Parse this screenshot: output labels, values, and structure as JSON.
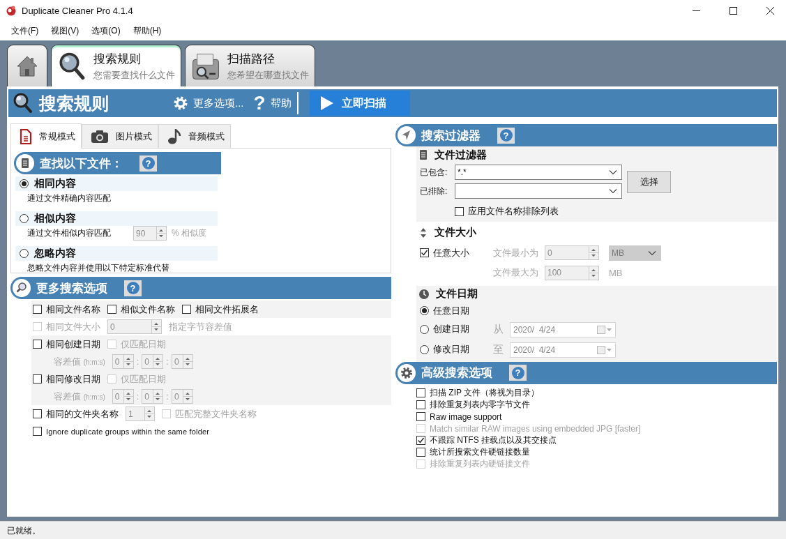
{
  "window": {
    "title": "Duplicate Cleaner Pro 4.1.4"
  },
  "menu": [
    "文件(F)",
    "视图(V)",
    "选项(O)",
    "帮助(H)"
  ],
  "main_tabs": [
    {
      "kind": "home",
      "selected": false
    },
    {
      "kind": "search",
      "title": "搜索规则",
      "subtitle": "您需要查找什么文件",
      "selected": true
    },
    {
      "kind": "scan",
      "title": "扫描路径",
      "subtitle": "您希望在哪查找文件",
      "selected": false
    }
  ],
  "header": {
    "title": "搜索规则",
    "actions": [
      {
        "kind": "more",
        "label": "更多选项..."
      },
      {
        "kind": "help",
        "icon": "?",
        "label": "帮助"
      }
    ],
    "scan_button": "立即扫描"
  },
  "mode_tabs": [
    {
      "kind": "document",
      "label": "常规模式",
      "selected": true
    },
    {
      "kind": "camera",
      "label": "图片模式",
      "selected": false
    },
    {
      "kind": "music",
      "label": "音频模式",
      "selected": false
    }
  ],
  "find_files": {
    "title": "查找以下文件：",
    "help": "?",
    "options": [
      {
        "label": "相同内容",
        "description": "通过文件精确内容匹配",
        "selected": true
      },
      {
        "label": "相似内容",
        "description": "通过文件相似内容匹配",
        "selected": false,
        "similarity": {
          "value": "90",
          "unit": "% 相似度",
          "disabled": true
        }
      },
      {
        "label": "忽略内容",
        "description": "忽略文件内容并使用以下特定标准代替",
        "selected": false
      }
    ]
  },
  "more_options": {
    "title": "更多搜索选项",
    "help": "?",
    "rows": [
      {
        "shaded": true,
        "items": [
          {
            "kind": "checkbox",
            "label": "相同文件名称",
            "checked": false,
            "disabled": false
          },
          {
            "kind": "checkbox",
            "label": "相似文件名称",
            "checked": false,
            "disabled": false
          },
          {
            "kind": "checkbox",
            "label": "相同文件拓展名",
            "checked": false,
            "disabled": false
          }
        ]
      },
      {
        "shaded": false,
        "items": [
          {
            "kind": "checkbox",
            "label": "相同文件大小",
            "checked": false,
            "disabled": true
          },
          {
            "kind": "spin",
            "value": "0",
            "disabled": true
          },
          {
            "kind": "note",
            "label": "指定字节容差值",
            "disabled": true
          }
        ]
      },
      {
        "shaded": true,
        "items": [
          {
            "kind": "checkbox",
            "label": "相同创建日期",
            "checked": false,
            "disabled": false
          },
          {
            "kind": "checkbox",
            "label": "仅匹配日期",
            "checked": false,
            "disabled": true
          }
        ]
      },
      {
        "shaded": true,
        "items": [
          {
            "kind": "tolerance",
            "label": "容差值",
            "unit": "(h:m:s)",
            "values": [
              "0",
              "0",
              "0"
            ],
            "separators": [
              ":",
              ":"
            ],
            "disabled": true
          }
        ]
      },
      {
        "shaded": true,
        "items": [
          {
            "kind": "checkbox",
            "label": "相同修改日期",
            "checked": false,
            "disabled": false
          },
          {
            "kind": "checkbox",
            "label": "仅匹配日期",
            "checked": false,
            "disabled": true
          }
        ]
      },
      {
        "shaded": true,
        "items": [
          {
            "kind": "tolerance",
            "label": "容差值",
            "unit": "(h:m:s)",
            "values": [
              "0",
              "0",
              "0"
            ],
            "separators": [
              ":",
              ":"
            ],
            "disabled": true
          }
        ]
      },
      {
        "shaded": false,
        "items": [
          {
            "kind": "checkbox",
            "label": "相同的文件夹名称",
            "checked": false,
            "disabled": false
          },
          {
            "kind": "small-spin",
            "value": "1",
            "disabled": true
          },
          {
            "kind": "checkbox",
            "label": "匹配完整文件夹名称",
            "checked": false,
            "disabled": true
          }
        ]
      },
      {
        "shaded": false,
        "items": [
          {
            "kind": "checkbox",
            "label": "Ignore duplicate groups within the same folder",
            "checked": false,
            "disabled": false
          }
        ]
      }
    ]
  },
  "search_filter": {
    "title": "搜索过滤器",
    "help": "?",
    "file_filter": {
      "title": "文件过滤器",
      "include": {
        "label": "已包含:",
        "value": "*.*"
      },
      "exclude": {
        "label": "已排除:"
      },
      "choose_button": "选择",
      "apply_exclusion": {
        "label": "应用文件名称排除列表",
        "checked": false,
        "disabled": false
      }
    },
    "file_size": {
      "title": "文件大小",
      "any": {
        "label": "任意大小",
        "checked": true,
        "disabled": false
      },
      "min": {
        "label": "文件最小为",
        "value": "0",
        "unit": {
          "kind": "dropdown",
          "value": "MB"
        },
        "disabled": true
      },
      "max": {
        "label": "文件最大为",
        "value": "100",
        "unit": {
          "kind": "text",
          "value": "MB"
        },
        "disabled": true
      }
    },
    "file_date": {
      "title": "文件日期",
      "options": [
        {
          "label": "任意日期",
          "selected": true
        },
        {
          "label": "创建日期",
          "prefix": "从",
          "date": "2020/  4/24",
          "selected": false
        },
        {
          "label": "修改日期",
          "prefix": "至",
          "date": "2020/  4/24",
          "selected": false
        }
      ]
    }
  },
  "advanced": {
    "title": "高级搜索选项",
    "help": "?",
    "options": [
      {
        "label": "扫描 ZIP 文件（将视为目录）",
        "checked": false,
        "disabled": false
      },
      {
        "label": "排除重复列表内零字节文件",
        "checked": false,
        "disabled": false
      },
      {
        "label": "Raw image support",
        "checked": false,
        "disabled": false
      },
      {
        "label": "Match similar RAW images using embedded JPG [faster]",
        "checked": false,
        "disabled": true
      },
      {
        "label": "不跟踪 NTFS 挂载点以及其交接点",
        "checked": true,
        "disabled": false
      },
      {
        "label": "统计所搜索文件硬链接数量",
        "checked": false,
        "disabled": false
      },
      {
        "label": "排除重复列表内硬链接文件",
        "checked": false,
        "disabled": true
      }
    ]
  },
  "status_bar": "已就绪。"
}
